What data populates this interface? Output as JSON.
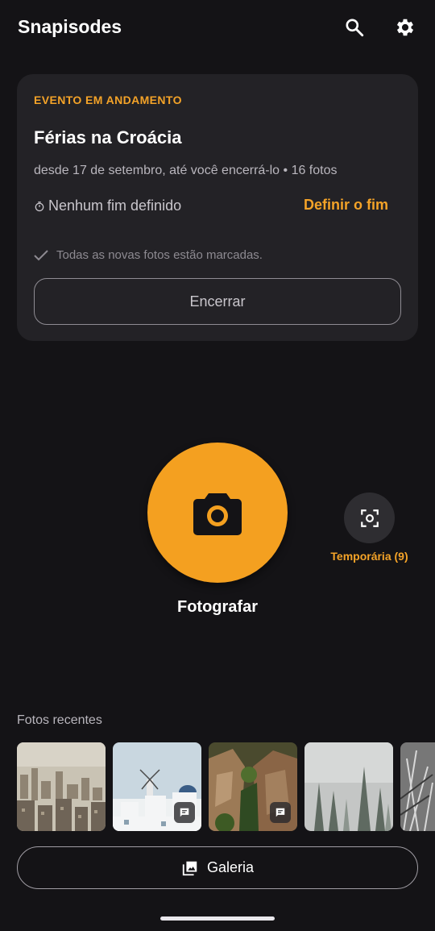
{
  "app": {
    "title": "Snapisodes",
    "icons": {
      "search": "search-icon",
      "settings": "gear-icon"
    }
  },
  "event_card": {
    "kicker": "EVENTO EM ANDAMENTO",
    "title": "Férias na Croácia",
    "meta": "desde 17 de setembro, até você encerrá-lo • 16 fotos",
    "end_status": "Nenhum fim definido",
    "set_end_label": "Definir o fim",
    "tag_note": "Todas as novas fotos estão marcadas.",
    "close_label": "Encerrar"
  },
  "capture": {
    "label": "Fotografar",
    "icon": "camera-icon"
  },
  "temporary": {
    "label": "Temporária (9)",
    "icon": "focus-scan-icon"
  },
  "recent": {
    "title": "Fotos recentes",
    "photos": [
      {
        "subject": "city-aerial",
        "has_comment": false
      },
      {
        "subject": "santorini-windmill",
        "has_comment": true
      },
      {
        "subject": "rock-cliffs-trees",
        "has_comment": true
      },
      {
        "subject": "foggy-forest",
        "has_comment": false
      },
      {
        "subject": "dry-grass-bw",
        "has_comment": false
      }
    ]
  },
  "gallery": {
    "label": "Galeria",
    "icon": "gallery-icon"
  },
  "colors": {
    "background": "#141316",
    "card": "#232226",
    "accent": "#f4a020"
  }
}
